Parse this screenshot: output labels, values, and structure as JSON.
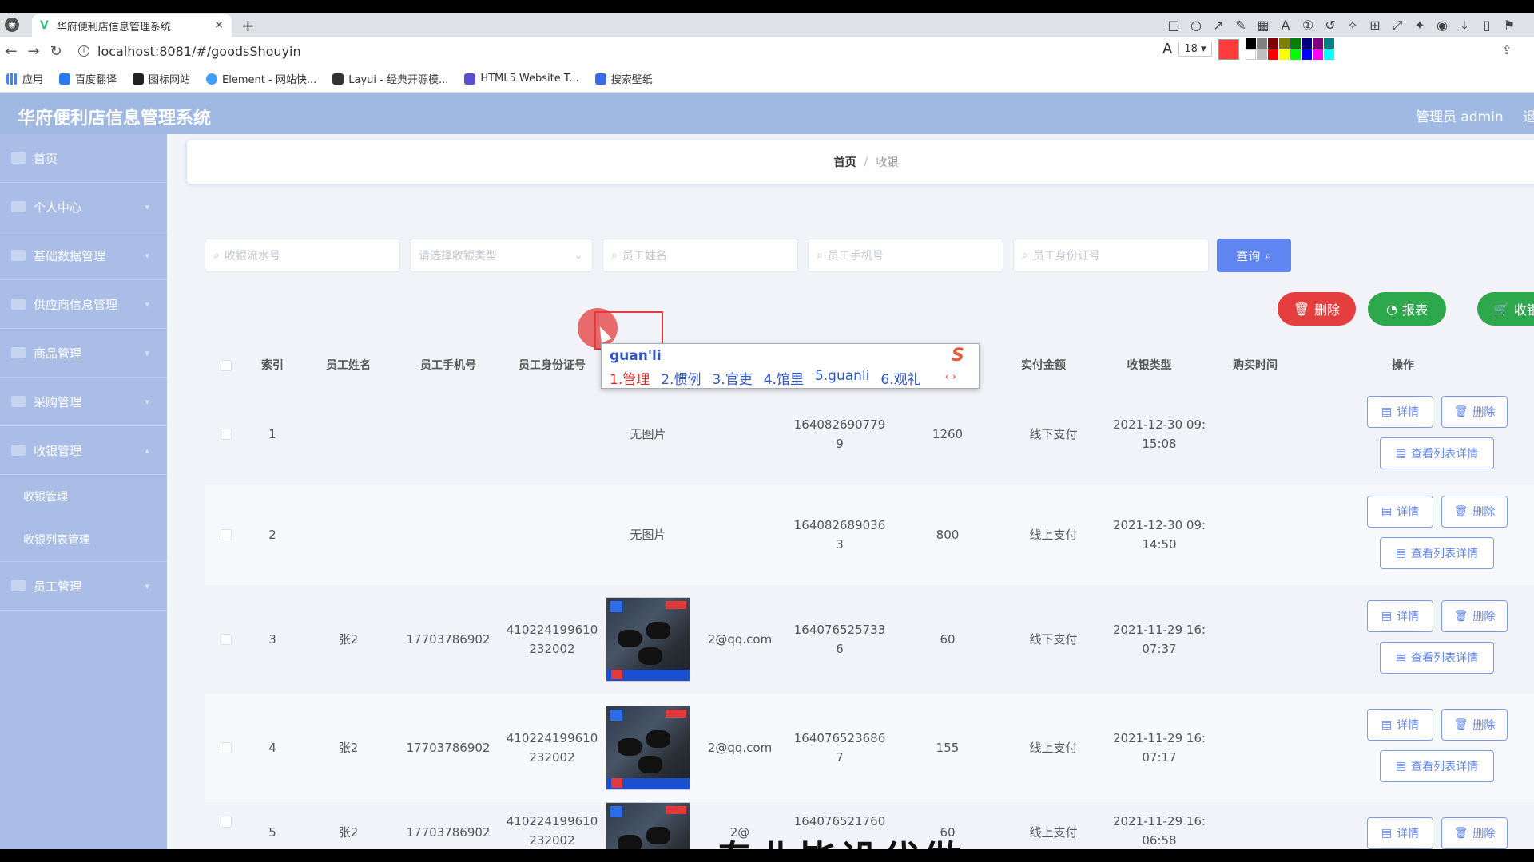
{
  "browser": {
    "tab_title": "华府便利店信息管理系统",
    "url": "localhost:8081/#/goodsShouyin",
    "font_size": "18",
    "bookmarks": [
      "应用",
      "百度翻译",
      "图标网站",
      "Element - 网站快...",
      "Layui - 经典开源模...",
      "HTML5 Website T...",
      "搜索壁纸"
    ]
  },
  "app": {
    "title": "华府便利店信息管理系统",
    "admin": "管理员 admin",
    "logout": "退"
  },
  "sidebar": {
    "items": [
      {
        "label": "首页"
      },
      {
        "label": "个人中心"
      },
      {
        "label": "基础数据管理"
      },
      {
        "label": "供应商信息管理"
      },
      {
        "label": "商品管理"
      },
      {
        "label": "采购管理"
      },
      {
        "label": "收银管理"
      }
    ],
    "sub_items": [
      "收银管理",
      "收银列表管理"
    ],
    "last_item": "员工管理"
  },
  "breadcrumb": {
    "home": "首页",
    "sep": "/",
    "current": "收银"
  },
  "filters": {
    "serial": "收银流水号",
    "type": "请选择收银类型",
    "name": "员工姓名",
    "phone": "员工手机号",
    "idcard": "员工身份证号",
    "search_label": "查询"
  },
  "actions": {
    "delete": "删除",
    "report": "报表",
    "cashier": "收银"
  },
  "table": {
    "headers": [
      "索引",
      "员工姓名",
      "员工手机号",
      "员工身份证号",
      "实付金额",
      "收银类型",
      "购买时间",
      "操作"
    ],
    "rows": [
      {
        "index": "1",
        "name": "",
        "phone": "",
        "idcard1": "",
        "idcard2": "",
        "photo": "无图片",
        "email": "",
        "serial1": "164082690779",
        "serial2": "9",
        "amount": "1260",
        "type": "线下支付",
        "time1": "2021-12-30 09:",
        "time2": "15:08"
      },
      {
        "index": "2",
        "name": "",
        "phone": "",
        "idcard1": "",
        "idcard2": "",
        "photo": "无图片",
        "email": "",
        "serial1": "164082689036",
        "serial2": "3",
        "amount": "800",
        "type": "线上支付",
        "time1": "2021-12-30 09:",
        "time2": "14:50"
      },
      {
        "index": "3",
        "name": "张2",
        "phone": "17703786902",
        "idcard1": "410224199610",
        "idcard2": "232002",
        "photo": "",
        "email": "2@qq.com",
        "serial1": "164076525733",
        "serial2": "6",
        "amount": "60",
        "type": "线下支付",
        "time1": "2021-11-29 16:",
        "time2": "07:37"
      },
      {
        "index": "4",
        "name": "张2",
        "phone": "17703786902",
        "idcard1": "410224199610",
        "idcard2": "232002",
        "photo": "",
        "email": "2@qq.com",
        "serial1": "164076523686",
        "serial2": "7",
        "amount": "155",
        "type": "线上支付",
        "time1": "2021-11-29 16:",
        "time2": "07:17"
      },
      {
        "index": "5",
        "name": "张2",
        "phone": "17703786902",
        "idcard1": "410224199610",
        "idcard2": "232002",
        "photo": "",
        "email": "2@",
        "serial1": "164076521760",
        "serial2": "",
        "amount": "60",
        "type": "线上支付",
        "time1": "2021-11-29 16:",
        "time2": "06:58"
      }
    ],
    "btn_detail": "详情",
    "btn_delete": "删除",
    "btn_list_detail": "查看列表详情"
  },
  "ime": {
    "input": "guan'li",
    "candidates": [
      "1.管理",
      "2.惯例",
      "3.官吏",
      "4.馆里",
      "5.guanli",
      "6.观礼"
    ]
  },
  "watermark": "专业毕设代做"
}
